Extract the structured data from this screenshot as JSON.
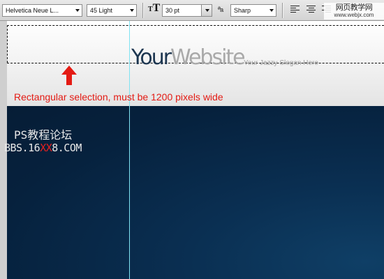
{
  "toolbar": {
    "font_family": "Helvetica Neue L...",
    "font_style": "45 Light",
    "font_size": "30 pt",
    "antialias": "Sharp",
    "text_size_icon": "text-size-icon",
    "antialias_icon": "aa-icon",
    "align_icons": [
      "align-left-icon",
      "align-center-icon",
      "align-right-icon"
    ]
  },
  "watermark_top": {
    "line1": "网页教学网",
    "line2": "www.webjx.com"
  },
  "canvas": {
    "logo_part1": "Your",
    "logo_part2": "Website",
    "slogan": "Your Jazzy Slogan Here",
    "annotation": "Rectangular selection, must be 1200 pixels wide",
    "watermark_line1": "PS教程论坛",
    "watermark_line2_a": "BBS.16",
    "watermark_line2_b": "XX",
    "watermark_line2_c": "8.COM"
  },
  "colors": {
    "annotation_red": "#e41b14",
    "guide_cyan": "#7fe3f2",
    "canvas_navy": "#06213d",
    "logo_dark": "#1d3650",
    "logo_light": "#a9a9a9"
  }
}
